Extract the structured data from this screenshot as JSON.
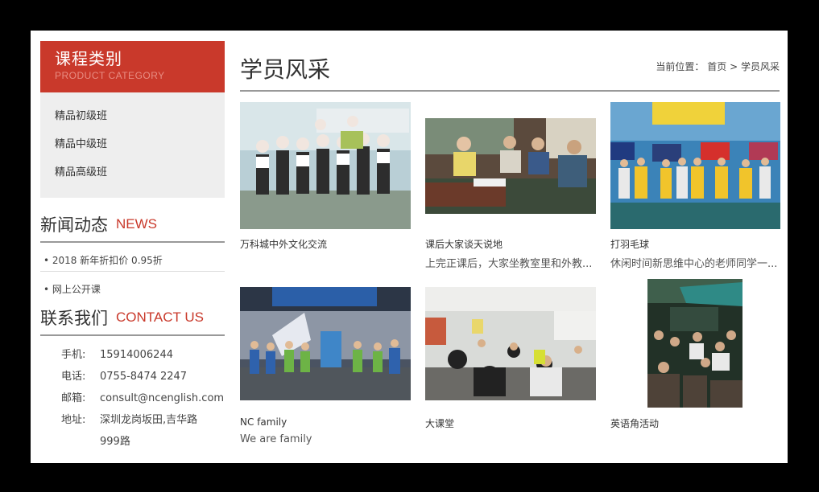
{
  "sidebar": {
    "category": {
      "title": "课程类别",
      "subtitle": "PRODUCT CATEGORY",
      "items": [
        "精品初级班",
        "精品中级班",
        "精品高级班"
      ]
    },
    "news": {
      "title_zh": "新闻动态",
      "title_en": "NEWS",
      "items": [
        "• 2018 新年折扣价 0.95折",
        "• 网上公开课"
      ]
    },
    "contact": {
      "title_zh": "联系我们",
      "title_en": "CONTACT US",
      "rows": [
        {
          "label": "手机:",
          "value": "15914006244"
        },
        {
          "label": "电话:",
          "value": "0755-8474 2247"
        },
        {
          "label": "邮箱:",
          "value": "consult@ncenglish.com"
        },
        {
          "label": "地址:",
          "value": "深圳龙岗坂田,吉华路999路"
        }
      ]
    }
  },
  "main": {
    "title": "学员风采",
    "breadcrumb": {
      "prefix": "当前位置：",
      "home": "首页",
      "sep": ">",
      "current": "学员风采"
    },
    "cards": [
      {
        "title": "万科城中外文化交流",
        "desc": ""
      },
      {
        "title": "课后大家谈天说地",
        "desc": "上完正课后，大家坐教室里和外教..."
      },
      {
        "title": "打羽毛球",
        "desc": "休闲时间新思维中心的老师同学一..."
      },
      {
        "title": "NC family",
        "desc": "We are family"
      },
      {
        "title": "大课堂",
        "desc": ""
      },
      {
        "title": "英语角活动",
        "desc": ""
      }
    ]
  },
  "colors": {
    "accent": "#c9392b",
    "sidebar_bg": "#eeeeee",
    "frame": "#000000"
  }
}
